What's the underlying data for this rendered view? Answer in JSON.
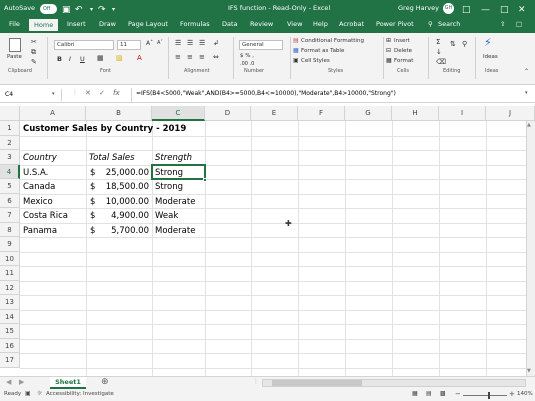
{
  "titlebar": {
    "autosave_label": "AutoSave",
    "autosave_state": "Off",
    "title": "IFS function - Read-Only - Excel",
    "user": "Greg Harvey",
    "avatar_initials": "GH"
  },
  "tabs": [
    "File",
    "Home",
    "Insert",
    "Draw",
    "Page Layout",
    "Formulas",
    "Data",
    "Review",
    "View",
    "Help",
    "Acrobat",
    "Power Pivot"
  ],
  "search_placeholder": "Search",
  "ribbon": {
    "paste_label": "Paste",
    "clipboard_label": "Clipboard",
    "font_name": "Calibri",
    "font_size": "11",
    "font_label": "Font",
    "alignment_label": "Alignment",
    "number_format": "General",
    "number_label": "Number",
    "conditional_formatting": "Conditional Formatting",
    "format_as_table": "Format as Table",
    "cell_styles": "Cell Styles",
    "styles_label": "Styles",
    "insert_label": "Insert",
    "delete_label": "Delete",
    "format_label": "Format",
    "cells_label": "Cells",
    "editing_label": "Editing",
    "ideas_label": "Ideas",
    "ideas_group_label": "Ideas",
    "number_extra": "$ % ,",
    "number_dec": ".00 .0"
  },
  "formula_bar": {
    "name_box": "C4",
    "fx": "fx",
    "formula": "=IFS(B4<5000,\"Weak\",AND(B4>=5000,B4<=10000),\"Moderate\",B4>10000,\"Strong\")"
  },
  "columns": [
    "A",
    "B",
    "C",
    "D",
    "E",
    "F",
    "G",
    "H",
    "I",
    "J"
  ],
  "rows": [
    "1",
    "2",
    "3",
    "4",
    "5",
    "6",
    "7",
    "8",
    "9",
    "10",
    "11",
    "12",
    "13",
    "14",
    "15",
    "16",
    "17"
  ],
  "sheet": {
    "title": "Customer Sales by Country - 2019",
    "headers": [
      "Country",
      "Total Sales",
      "Strength"
    ],
    "data": [
      {
        "country": "U.S.A.",
        "cur": "$",
        "sales": "25,000.00",
        "strength": "Strong"
      },
      {
        "country": "Canada",
        "cur": "$",
        "sales": "18,500.00",
        "strength": "Strong"
      },
      {
        "country": "Mexico",
        "cur": "$",
        "sales": "10,000.00",
        "strength": "Moderate"
      },
      {
        "country": "Costa Rica",
        "cur": "$",
        "sales": "4,900.00",
        "strength": "Weak"
      },
      {
        "country": "Panama",
        "cur": "$",
        "sales": "5,700.00",
        "strength": "Moderate"
      }
    ]
  },
  "sheet_tab": "Sheet1",
  "status": {
    "ready": "Ready",
    "accessibility": "Accessibility: Investigate",
    "zoom": "140%"
  },
  "colors": {
    "accent": "#217346"
  }
}
